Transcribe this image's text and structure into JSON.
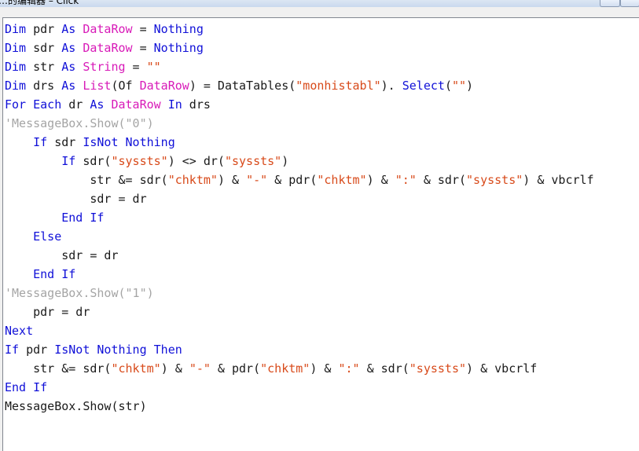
{
  "window": {
    "title": "…的编辑器 – Click"
  },
  "colors": {
    "keyword": "#1010d8",
    "type": "#d81ab8",
    "string": "#d84a1a",
    "comment": "#a5a5a5",
    "plain": "#1a1a1a"
  },
  "code": {
    "lines": [
      [
        [
          "kw",
          "Dim"
        ],
        [
          "p",
          " pdr "
        ],
        [
          "kw",
          "As"
        ],
        [
          "p",
          " "
        ],
        [
          "ty",
          "DataRow"
        ],
        [
          "p",
          " = "
        ],
        [
          "kw",
          "Nothing"
        ]
      ],
      [
        [
          "kw",
          "Dim"
        ],
        [
          "p",
          " sdr "
        ],
        [
          "kw",
          "As"
        ],
        [
          "p",
          " "
        ],
        [
          "ty",
          "DataRow"
        ],
        [
          "p",
          " = "
        ],
        [
          "kw",
          "Nothing"
        ]
      ],
      [
        [
          "kw",
          "Dim"
        ],
        [
          "p",
          " str "
        ],
        [
          "kw",
          "As"
        ],
        [
          "p",
          " "
        ],
        [
          "ty",
          "String"
        ],
        [
          "p",
          " = "
        ],
        [
          "st",
          "\"\""
        ]
      ],
      [
        [
          "kw",
          "Dim"
        ],
        [
          "p",
          " drs "
        ],
        [
          "kw",
          "As"
        ],
        [
          "p",
          " "
        ],
        [
          "ty",
          "List"
        ],
        [
          "p",
          "(Of "
        ],
        [
          "ty",
          "DataRow"
        ],
        [
          "p",
          ") = DataTables("
        ],
        [
          "st",
          "\"monhistabl\""
        ],
        [
          "p",
          "). "
        ],
        [
          "kw",
          "Select"
        ],
        [
          "p",
          "("
        ],
        [
          "st",
          "\"\""
        ],
        [
          "p",
          ")"
        ]
      ],
      [
        [
          "kw",
          "For Each"
        ],
        [
          "p",
          " dr "
        ],
        [
          "kw",
          "As"
        ],
        [
          "p",
          " "
        ],
        [
          "ty",
          "DataRow"
        ],
        [
          "p",
          " "
        ],
        [
          "kw",
          "In"
        ],
        [
          "p",
          " drs"
        ]
      ],
      [
        [
          "cm",
          "'MessageBox.Show(\"0\")"
        ]
      ],
      [
        [
          "p",
          "    "
        ],
        [
          "kw",
          "If"
        ],
        [
          "p",
          " sdr "
        ],
        [
          "kw",
          "IsNot"
        ],
        [
          "p",
          " "
        ],
        [
          "kw",
          "Nothing"
        ]
      ],
      [
        [
          "p",
          "        "
        ],
        [
          "kw",
          "If"
        ],
        [
          "p",
          " sdr("
        ],
        [
          "st",
          "\"syssts\""
        ],
        [
          "p",
          ") <> dr("
        ],
        [
          "st",
          "\"syssts\""
        ],
        [
          "p",
          ")"
        ]
      ],
      [
        [
          "p",
          "            str &= sdr("
        ],
        [
          "st",
          "\"chktm\""
        ],
        [
          "p",
          ") & "
        ],
        [
          "st",
          "\"-\""
        ],
        [
          "p",
          " & pdr("
        ],
        [
          "st",
          "\"chktm\""
        ],
        [
          "p",
          ") & "
        ],
        [
          "st",
          "\":\""
        ],
        [
          "p",
          " & sdr("
        ],
        [
          "st",
          "\"syssts\""
        ],
        [
          "p",
          ") & vbcrlf"
        ]
      ],
      [
        [
          "p",
          "            sdr = dr"
        ]
      ],
      [
        [
          "p",
          "        "
        ],
        [
          "kw",
          "End If"
        ]
      ],
      [
        [
          "p",
          "    "
        ],
        [
          "kw",
          "Else"
        ]
      ],
      [
        [
          "p",
          "        sdr = dr"
        ]
      ],
      [
        [
          "p",
          "    "
        ],
        [
          "kw",
          "End If"
        ]
      ],
      [
        [
          "cm",
          "'MessageBox.Show(\"1\")"
        ]
      ],
      [
        [
          "p",
          "    pdr = dr"
        ]
      ],
      [
        [
          "kw",
          "Next"
        ]
      ],
      [
        [
          "kw",
          "If"
        ],
        [
          "p",
          " pdr "
        ],
        [
          "kw",
          "IsNot"
        ],
        [
          "p",
          " "
        ],
        [
          "kw",
          "Nothing"
        ],
        [
          "p",
          " "
        ],
        [
          "kw",
          "Then"
        ]
      ],
      [
        [
          "p",
          "    str &= sdr("
        ],
        [
          "st",
          "\"chktm\""
        ],
        [
          "p",
          ") & "
        ],
        [
          "st",
          "\"-\""
        ],
        [
          "p",
          " & pdr("
        ],
        [
          "st",
          "\"chktm\""
        ],
        [
          "p",
          ") & "
        ],
        [
          "st",
          "\":\""
        ],
        [
          "p",
          " & sdr("
        ],
        [
          "st",
          "\"syssts\""
        ],
        [
          "p",
          ") & vbcrlf"
        ]
      ],
      [
        [
          "kw",
          "End If"
        ]
      ],
      [
        [
          "p",
          "MessageBox.Show(str)"
        ]
      ]
    ]
  }
}
